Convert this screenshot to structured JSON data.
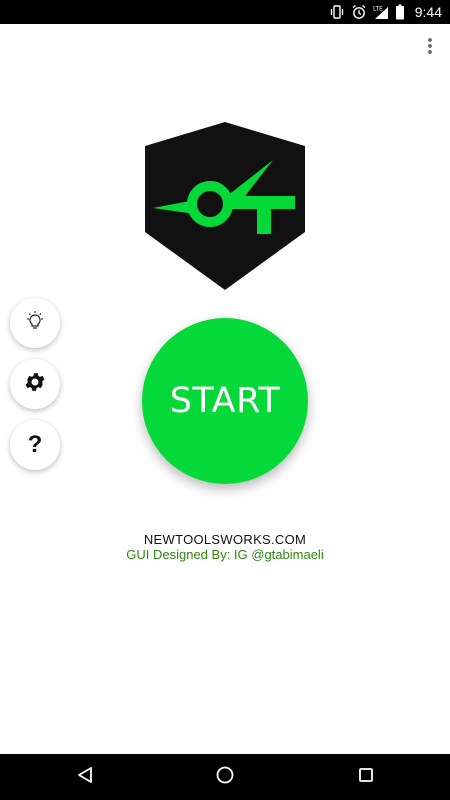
{
  "status_bar": {
    "time": "9:44",
    "icons": [
      "vibrate-icon",
      "alarm-icon",
      "lte-signal-icon",
      "signal-icon",
      "battery-icon"
    ],
    "network_label": "LTE"
  },
  "overflow_menu": {
    "icon": "more-vert-icon"
  },
  "logo": {
    "icon": "app-logo",
    "colors": {
      "shield": "#111111",
      "mark": "#05d93a"
    }
  },
  "start_button": {
    "label": "START",
    "color": "#05d93a"
  },
  "side_buttons": [
    {
      "name": "tips",
      "icon": "lightbulb-icon"
    },
    {
      "name": "settings",
      "icon": "gear-icon"
    },
    {
      "name": "help",
      "icon": "question-icon",
      "glyph": "?"
    }
  ],
  "credits": {
    "website": "NEWTOOLSWORKS.COM",
    "designer": "GUI  Designed By: IG @gtabimaeli",
    "designer_color": "#2e8a0f"
  },
  "nav_bar": {
    "back": "back-icon",
    "home": "home-icon",
    "recents": "recents-icon"
  }
}
